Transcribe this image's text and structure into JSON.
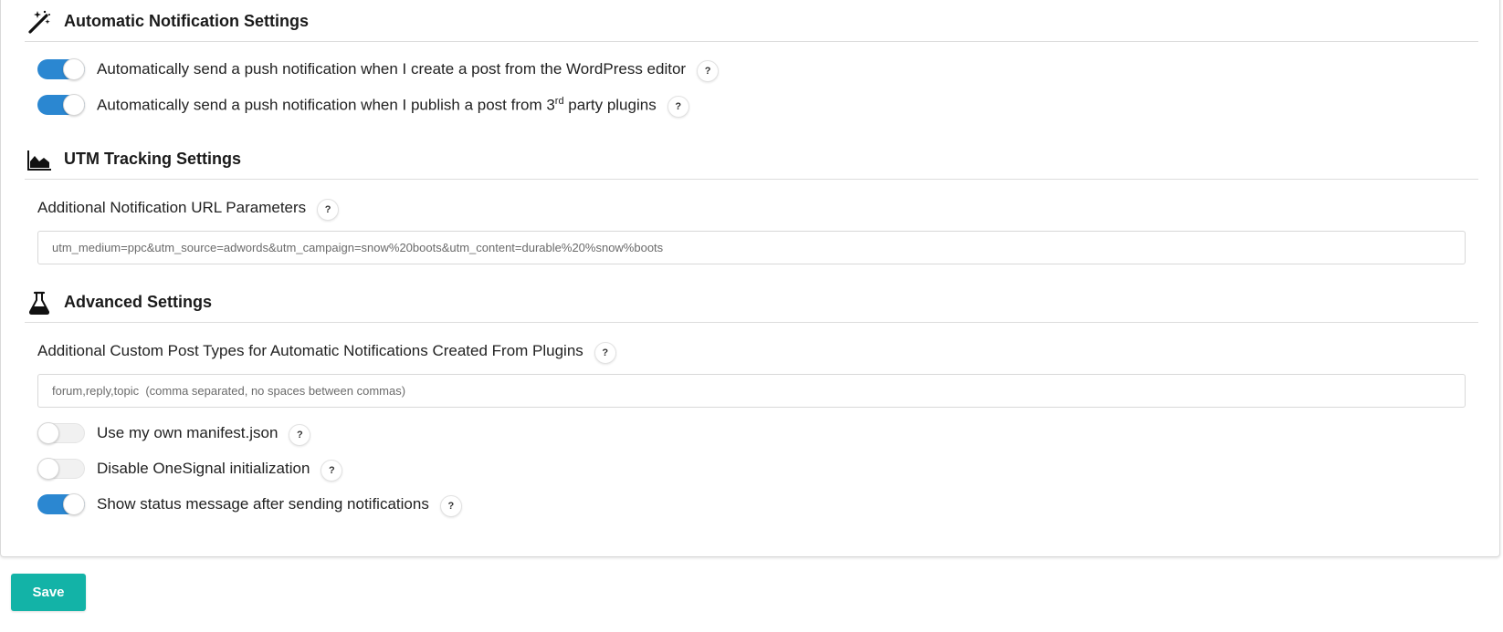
{
  "sections": {
    "automatic": {
      "title": "Automatic Notification Settings",
      "icon": "magic-wand-icon",
      "options": [
        {
          "label_before": "Automatically send a push notification when I create a post from the WordPress editor",
          "label_sup": "",
          "label_after": "",
          "enabled": true,
          "help": "?"
        },
        {
          "label_before": "Automatically send a push notification when I publish a post from 3",
          "label_sup": "rd",
          "label_after": " party plugins",
          "enabled": true,
          "help": "?"
        }
      ]
    },
    "utm": {
      "title": "UTM Tracking Settings",
      "icon": "area-chart-icon",
      "field_label": "Additional Notification URL Parameters",
      "field_placeholder": "utm_medium=ppc&utm_source=adwords&utm_campaign=snow%20boots&utm_content=durable%20%snow%boots",
      "field_value": "",
      "help": "?"
    },
    "advanced": {
      "title": "Advanced Settings",
      "icon": "flask-icon",
      "field_label": "Additional Custom Post Types for Automatic Notifications Created From Plugins",
      "field_placeholder": "forum,reply,topic  (comma separated, no spaces between commas)",
      "field_value": "",
      "help": "?",
      "options": [
        {
          "label": "Use my own manifest.json",
          "enabled": false,
          "help": "?"
        },
        {
          "label": "Disable OneSignal initialization",
          "enabled": false,
          "help": "?"
        },
        {
          "label": "Show status message after sending notifications",
          "enabled": true,
          "help": "?"
        }
      ]
    }
  },
  "save_button": {
    "label": "Save"
  },
  "colors": {
    "toggle_on": "#2b87d1",
    "toggle_off": "#f1f1f1",
    "save": "#13b3a7"
  }
}
